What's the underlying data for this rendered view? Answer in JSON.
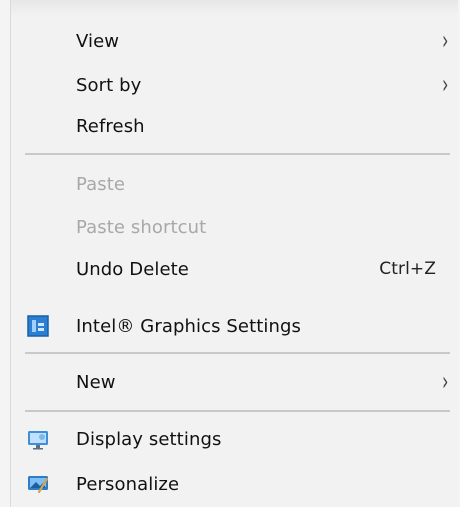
{
  "menu": {
    "items": [
      {
        "label": "View",
        "has_submenu": true,
        "disabled": false
      },
      {
        "label": "Sort by",
        "has_submenu": true,
        "disabled": false
      },
      {
        "label": "Refresh",
        "has_submenu": false,
        "disabled": false
      }
    ],
    "clipboard": [
      {
        "label": "Paste",
        "disabled": true
      },
      {
        "label": "Paste shortcut",
        "disabled": true
      },
      {
        "label": "Undo Delete",
        "shortcut": "Ctrl+Z",
        "disabled": false
      }
    ],
    "intel": {
      "label": "Intel® Graphics Settings",
      "icon": "intel-graphics-icon"
    },
    "new": {
      "label": "New",
      "has_submenu": true
    },
    "display": {
      "label": "Display settings",
      "icon": "display-settings-icon"
    },
    "personalize": {
      "label": "Personalize",
      "icon": "personalize-icon"
    },
    "submenu_glyph": "›"
  }
}
